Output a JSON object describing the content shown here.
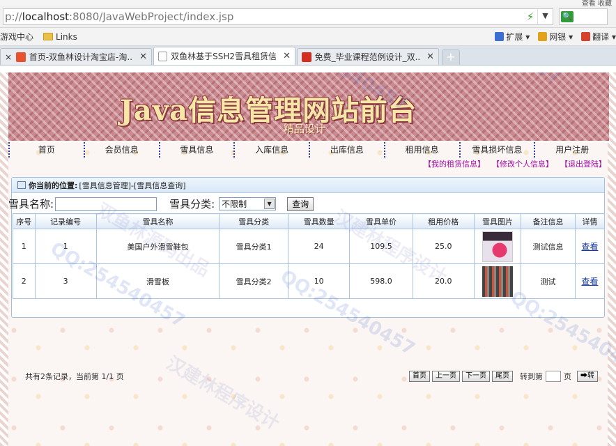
{
  "browser": {
    "top_right_text": "查看  收藏",
    "url_prefix": "p://",
    "url_host": "localhost",
    "url_rest": ":8080/JavaWebProject/index.jsp",
    "favorites": [
      {
        "label": "游戏中心"
      },
      {
        "label": "Links"
      }
    ],
    "toolbar_right": [
      {
        "label": "扩展",
        "color": "#3b6fd4"
      },
      {
        "label": "网银",
        "color": "#e2a21a"
      },
      {
        "label": "翻译",
        "color": "#d8402e"
      }
    ],
    "tabs": [
      {
        "label": "首页-双鱼林设计淘宝店-淘...",
        "active": false,
        "icon_color": "#e8512d"
      },
      {
        "label": "双鱼林基于SSH2雪具租赁信...",
        "active": true,
        "icon_color": "#ffffff"
      },
      {
        "label": "免费_毕业课程范例设计_双...",
        "active": false,
        "icon_color": "#d42d1f"
      }
    ],
    "new_tab": "+"
  },
  "site": {
    "title": "Java信息管理网站前台",
    "subtitle": "精品设计",
    "nav": [
      "首页",
      "会员信息",
      "雪具信息",
      "入库信息",
      "出库信息",
      "租用信息",
      "雪具损坏信息",
      "用户注册"
    ],
    "user_links": [
      "【我的租赁信息】",
      "【修改个人信息】",
      "【退出登陆】"
    ]
  },
  "panel": {
    "location_label": "你当前的位置:",
    "location_path": "[雪具信息管理]-[雪具信息查询]"
  },
  "search": {
    "name_label": "雪具名称:",
    "name_value": "",
    "category_label": "雪具分类:",
    "category_value": "不限制",
    "query_button": "查询"
  },
  "table": {
    "headers": [
      "序号",
      "记录编号",
      "雪具名称",
      "雪具分类",
      "雪具数量",
      "雪具单价",
      "租用价格",
      "雪具图片",
      "备注信息",
      "详情"
    ],
    "rows": [
      {
        "seq": "1",
        "id": "1",
        "name": "美国户外滑雪鞋包",
        "category": "雪具分类1",
        "qty": "24",
        "price": "109.5",
        "rent": "25.0",
        "image": "bag",
        "note": "测试信息",
        "detail": "查看"
      },
      {
        "seq": "2",
        "id": "3",
        "name": "滑雪板",
        "category": "雪具分类2",
        "qty": "10",
        "price": "598.0",
        "rent": "20.0",
        "image": "ski",
        "note": "测试",
        "detail": "查看"
      }
    ]
  },
  "pager": {
    "info": "共有2条记录，当前第 1/1 页",
    "first": "首页",
    "prev": "上一页",
    "next": "下一页",
    "last": "尾页",
    "goto_label": "转到第",
    "page_unit": "页",
    "go_button": "➡转",
    "page_value": ""
  },
  "watermarks": [
    "QQ:254540457",
    "双鱼林源码出品",
    "汉建林程序设计"
  ]
}
